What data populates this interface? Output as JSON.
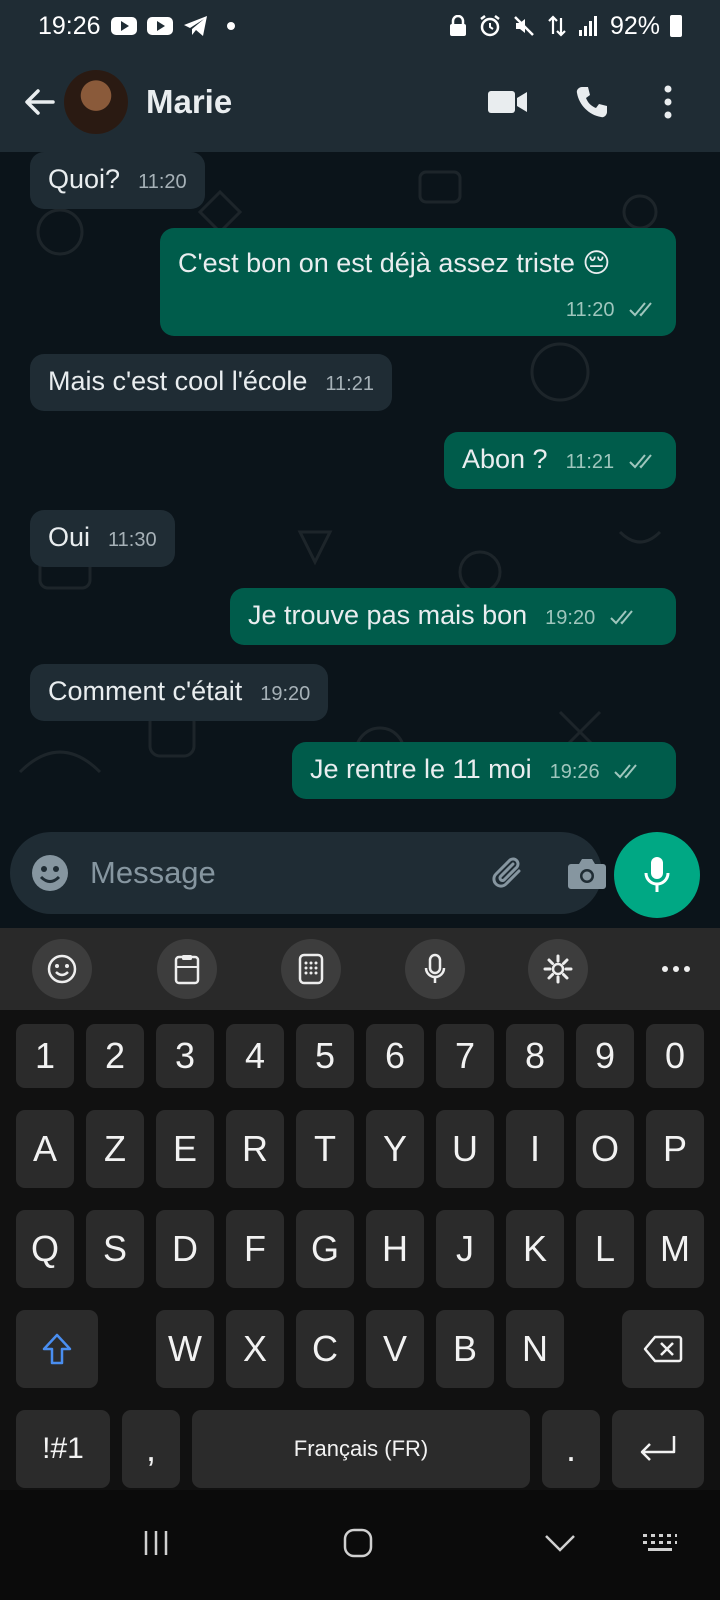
{
  "status_bar": {
    "time": "19:26",
    "battery": "92%"
  },
  "header": {
    "contact_name": "Marie"
  },
  "messages": [
    {
      "dir": "in",
      "text": "Quoi?",
      "time": "11:20"
    },
    {
      "dir": "out",
      "text": "C'est bon on est déjà assez triste 😔",
      "time": "11:20"
    },
    {
      "dir": "in",
      "text": "Mais c'est cool l'école",
      "time": "11:21"
    },
    {
      "dir": "out",
      "text": "Abon ?",
      "time": "11:21"
    },
    {
      "dir": "in",
      "text": "Oui",
      "time": "11:30"
    },
    {
      "dir": "out",
      "text": "Je trouve pas mais bon",
      "time": "19:20"
    },
    {
      "dir": "in",
      "text": "Comment c'était",
      "time": "19:20"
    },
    {
      "dir": "out",
      "text": "Je rentre le 11 moi",
      "time": "19:26"
    }
  ],
  "composer": {
    "placeholder": "Message"
  },
  "keyboard": {
    "row_numbers": [
      "1",
      "2",
      "3",
      "4",
      "5",
      "6",
      "7",
      "8",
      "9",
      "0"
    ],
    "row1": [
      "A",
      "Z",
      "E",
      "R",
      "T",
      "Y",
      "U",
      "I",
      "O",
      "P"
    ],
    "row2": [
      "Q",
      "S",
      "D",
      "F",
      "G",
      "H",
      "J",
      "K",
      "L",
      "M"
    ],
    "row3": [
      "W",
      "X",
      "C",
      "V",
      "B",
      "N"
    ],
    "symbols_key": "!#1",
    "comma_key": ",",
    "space_label": "Français (FR)",
    "period_key": "."
  },
  "colors": {
    "incoming": "#1f2c34",
    "outgoing": "#005c4b",
    "accent": "#00a884",
    "background": "#0b141a"
  }
}
